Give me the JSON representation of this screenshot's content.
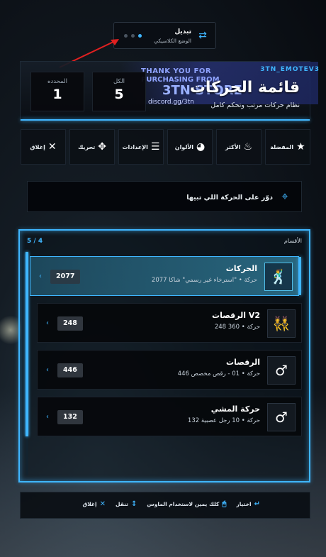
{
  "toggle": {
    "title": "تبديل",
    "subtitle": "الوضع الكلاسيكي",
    "icon": "swap-icon"
  },
  "header": {
    "title": "قائمة الحركات",
    "subtitle": "نظام حركات مرتب وتحكم كامل",
    "banner": {
      "line1": "THANK YOU FOR",
      "line2": "PURCHASING FROM",
      "line3": "3TN STORE",
      "line4": "discord.gg/3tn",
      "tag": "3TN_EMOTEV3"
    },
    "stats": [
      {
        "label": "الكل",
        "value": "5"
      },
      {
        "label": "المحدده",
        "value": "1"
      }
    ]
  },
  "actions": [
    {
      "label": "المفضلة",
      "icon": "star-icon"
    },
    {
      "label": "الأكثر",
      "icon": "fire-icon"
    },
    {
      "label": "الألوان",
      "icon": "palette-icon"
    },
    {
      "label": "الإعدادات",
      "icon": "sliders-icon"
    },
    {
      "label": "تحريك",
      "icon": "move-icon"
    },
    {
      "label": "إغلاق",
      "icon": "close-icon"
    }
  ],
  "search": {
    "placeholder": "دوّر على الحركة اللي تبيها",
    "value": ""
  },
  "categories": {
    "header": "الأقسام",
    "page": "5 / 4",
    "items": [
      {
        "name": "الحركات",
        "desc": "2077 حركة • \"استرخاء غير رسمي\" شاكا",
        "count": "2077",
        "icon": "dancer-icon",
        "active": true
      },
      {
        "name": "الرقصات V2",
        "desc": "248 حركة • 360",
        "count": "248",
        "icon": "couple-dance-icon",
        "active": false
      },
      {
        "name": "الرقصات",
        "desc": "446 حركة • 01 - رقص مخصص",
        "count": "446",
        "icon": "gender-unknown-icon",
        "active": false
      },
      {
        "name": "حركة المشي",
        "desc": "132 حركة • 10 رجل عصبية",
        "count": "132",
        "icon": "gender-unknown-icon",
        "active": false
      }
    ]
  },
  "footer": {
    "items": [
      {
        "label": "اختيار",
        "key": "↵"
      },
      {
        "label": "كلك يمين لاستخدام الماوس",
        "key": "🖱"
      },
      {
        "label": "تنقل",
        "key": "↕"
      },
      {
        "label": "إغلاق",
        "key": "✕"
      }
    ]
  },
  "colors": {
    "accent": "#3fb6ff",
    "panel": "#0a0e14"
  }
}
